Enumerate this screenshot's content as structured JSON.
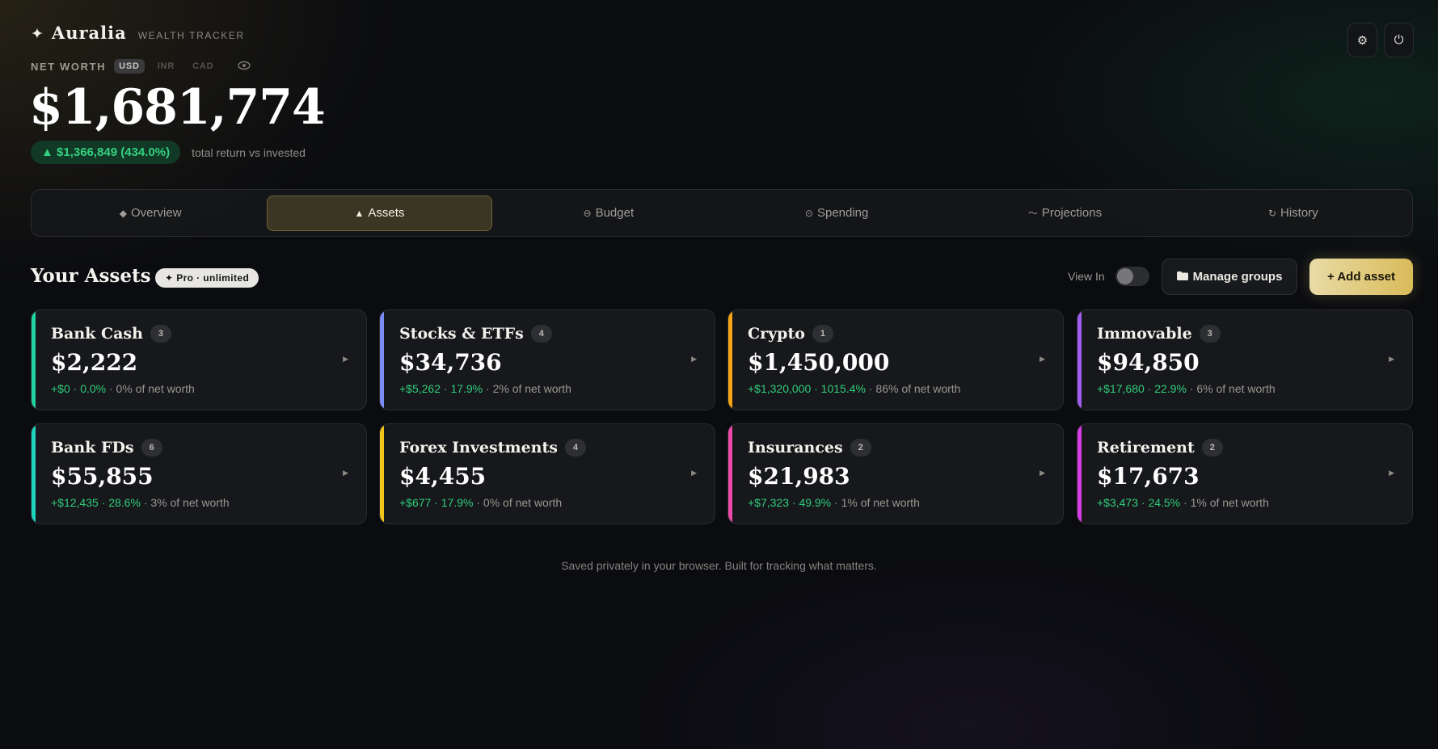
{
  "brand": {
    "star": "✦",
    "name": "Auralia",
    "tagline": "WEALTH TRACKER"
  },
  "networth": {
    "label": "NET WORTH",
    "currencies": [
      "USD",
      "INR",
      "CAD"
    ],
    "selected_currency": "USD",
    "eye_icon": "eye-icon",
    "value": "$1,681,774",
    "return_value": "▲ $1,366,849 (434.0%)",
    "return_label": "total return vs invested"
  },
  "top_actions": {
    "settings_icon": "⚙",
    "power_icon": "⏻"
  },
  "tabs": [
    {
      "icon": "◆",
      "label": "Overview",
      "active": false
    },
    {
      "icon": "▲",
      "label": "Assets",
      "active": true
    },
    {
      "icon": "⊖",
      "label": "Budget",
      "active": false
    },
    {
      "icon": "⊙",
      "label": "Spending",
      "active": false
    },
    {
      "icon": "〜",
      "label": "Projections",
      "active": false
    },
    {
      "icon": "↻",
      "label": "History",
      "active": false
    }
  ],
  "assets_section": {
    "title": "Your Assets",
    "badge": "✦ Pro · unlimited",
    "view_in_label": "View In",
    "manage_label": "Manage groups",
    "add_label": "+ Add asset"
  },
  "cards": [
    {
      "name": "Bank Cash",
      "count": "3",
      "value": "$2,222",
      "gain": "+$0 · 0.0%",
      "share": " · 0% of net worth",
      "color": "#22d3a0"
    },
    {
      "name": "Stocks & ETFs",
      "count": "4",
      "value": "$34,736",
      "gain": "+$5,262 · 17.9%",
      "share": " · 2% of net worth",
      "color": "#7b8cf5"
    },
    {
      "name": "Crypto",
      "count": "1",
      "value": "$1,450,000",
      "gain": "+$1,320,000 · 1015.4%",
      "share": " · 86% of net worth",
      "color": "#f5a614"
    },
    {
      "name": "Immovable",
      "count": "3",
      "value": "$94,850",
      "gain": "+$17,680 · 22.9%",
      "share": " · 6% of net worth",
      "color": "#a35cf0"
    },
    {
      "name": "Bank FDs",
      "count": "6",
      "value": "$55,855",
      "gain": "+$12,435 · 28.6%",
      "share": " · 3% of net worth",
      "color": "#1fd4bd"
    },
    {
      "name": "Forex Investments",
      "count": "4",
      "value": "$4,455",
      "gain": "+$677 · 17.9%",
      "share": " · 0% of net worth",
      "color": "#f0c419"
    },
    {
      "name": "Insurances",
      "count": "2",
      "value": "$21,983",
      "gain": "+$7,323 · 49.9%",
      "share": " · 1% of net worth",
      "color": "#ec4aa8"
    },
    {
      "name": "Retirement",
      "count": "2",
      "value": "$17,673",
      "gain": "+$3,473 · 24.5%",
      "share": " · 1% of net worth",
      "color": "#d83ce6"
    }
  ],
  "footer": "Saved privately in your browser. Built for tracking what matters."
}
